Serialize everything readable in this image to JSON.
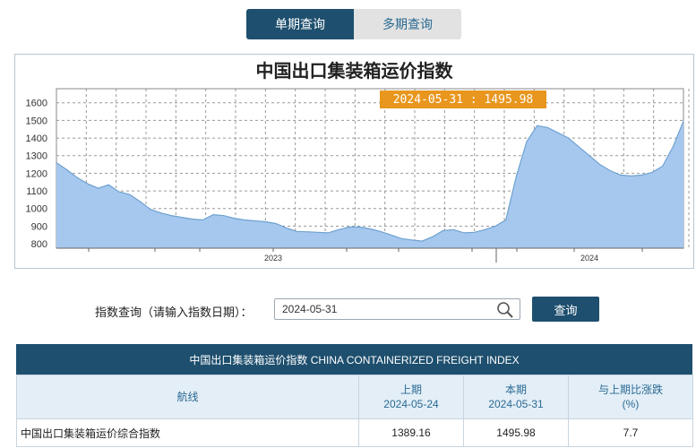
{
  "tabs": [
    {
      "label": "单期查询",
      "active": true
    },
    {
      "label": "多期查询",
      "active": false
    }
  ],
  "chart": {
    "title": "中国出口集装箱运价指数",
    "tooltip": "2024-05-31 : 1495.98"
  },
  "chart_data": {
    "type": "area",
    "title": "中国出口集装箱运价指数",
    "ylim": [
      775,
      1680
    ],
    "yticks": [
      "1600",
      "1500",
      "1400",
      "1300",
      "1200",
      "1100",
      "1000",
      "900",
      "800"
    ],
    "xticks": [
      "2023",
      "2024"
    ],
    "grid": true,
    "fill_color": "#a6c8ef",
    "line_color": "#6ea1cf",
    "y": [
      1260,
      1220,
      1175,
      1140,
      1115,
      1135,
      1095,
      1080,
      1040,
      995,
      975,
      960,
      950,
      940,
      935,
      965,
      960,
      945,
      935,
      930,
      925,
      915,
      890,
      870,
      868,
      865,
      862,
      880,
      895,
      895,
      885,
      870,
      850,
      830,
      822,
      815,
      840,
      875,
      880,
      862,
      865,
      880,
      900,
      935,
      1180,
      1380,
      1470,
      1460,
      1430,
      1400,
      1350,
      1300,
      1250,
      1215,
      1190,
      1185,
      1190,
      1205,
      1240,
      1350,
      1496
    ],
    "tooltip_point": {
      "date": "2024-05-31",
      "value": 1495.98
    }
  },
  "query": {
    "label": "指数查询（请输入指数日期）：",
    "date_value": "2024-05-31",
    "button_label": "查询"
  },
  "table": {
    "title": "中国出口集装箱运价指数 CHINA CONTAINERIZED FREIGHT INDEX",
    "headers": {
      "route": "航线",
      "prev_line1": "上期",
      "prev_line2": "2024-05-24",
      "curr_line1": "本期",
      "curr_line2": "2024-05-31",
      "change_line1": "与上期比涨跌",
      "change_line2": "(%)"
    },
    "rows": [
      {
        "route": "中国出口集装箱运价综合指数",
        "prev": "1389.16",
        "curr": "1495.98",
        "change": "7.7"
      }
    ]
  }
}
